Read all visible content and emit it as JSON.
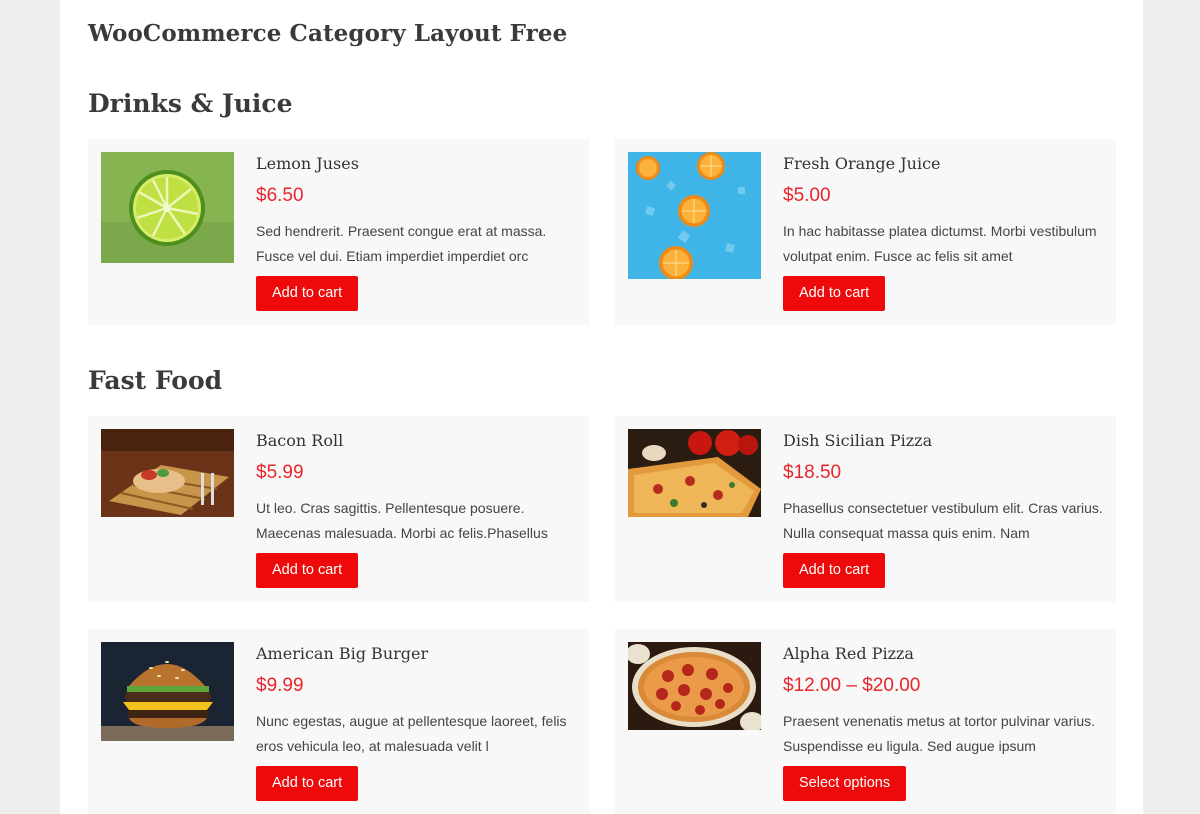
{
  "page": {
    "title": "WooCommerce Category Layout Free"
  },
  "sections": [
    {
      "heading": "Drinks & Juice",
      "products": [
        {
          "name": "Lemon Juses",
          "price": "$6.50",
          "description": "Sed hendrerit. Praesent congue erat at massa. Fusce vel dui. Etiam imperdiet imperdiet orc",
          "button": "Add to cart",
          "image": "lime-slice-image"
        },
        {
          "name": "Fresh Orange Juice",
          "price": "$5.00",
          "description": "In hac habitasse platea dictumst. Morbi vestibulum volutpat enim. Fusce ac felis sit amet",
          "button": "Add to cart",
          "image": "orange-slices-image"
        }
      ]
    },
    {
      "heading": "Fast Food",
      "products": [
        {
          "name": "Bacon Roll",
          "price": "$5.99",
          "description": "Ut leo. Cras sagittis. Pellentesque posuere. Maecenas malesuada. Morbi ac felis.Phasellus",
          "button": "Add to cart",
          "image": "bacon-roll-image"
        },
        {
          "name": "Dish Sicilian Pizza",
          "price": "$18.50",
          "description": "Phasellus consectetuer vestibulum elit. Cras varius. Nulla consequat massa quis enim. Nam",
          "button": "Add to cart",
          "image": "sicilian-pizza-image"
        },
        {
          "name": "American Big Burger",
          "price": "$9.99",
          "description": "Nunc egestas, augue at pellentesque laoreet, felis eros vehicula leo, at malesuada velit l",
          "button": "Add to cart",
          "image": "burger-image"
        },
        {
          "name": "Alpha Red Pizza",
          "price": "$12.00 – $20.00",
          "description": "Praesent venenatis metus at tortor pulvinar varius. Suspendisse eu ligula. Sed augue ipsum",
          "button": "Select options",
          "image": "pepperoni-pizza-image"
        }
      ]
    }
  ],
  "colors": {
    "accent": "#ee0a0a",
    "price": "#e8262c",
    "card_background": "#f8f8f8",
    "page_background": "#efefef"
  }
}
